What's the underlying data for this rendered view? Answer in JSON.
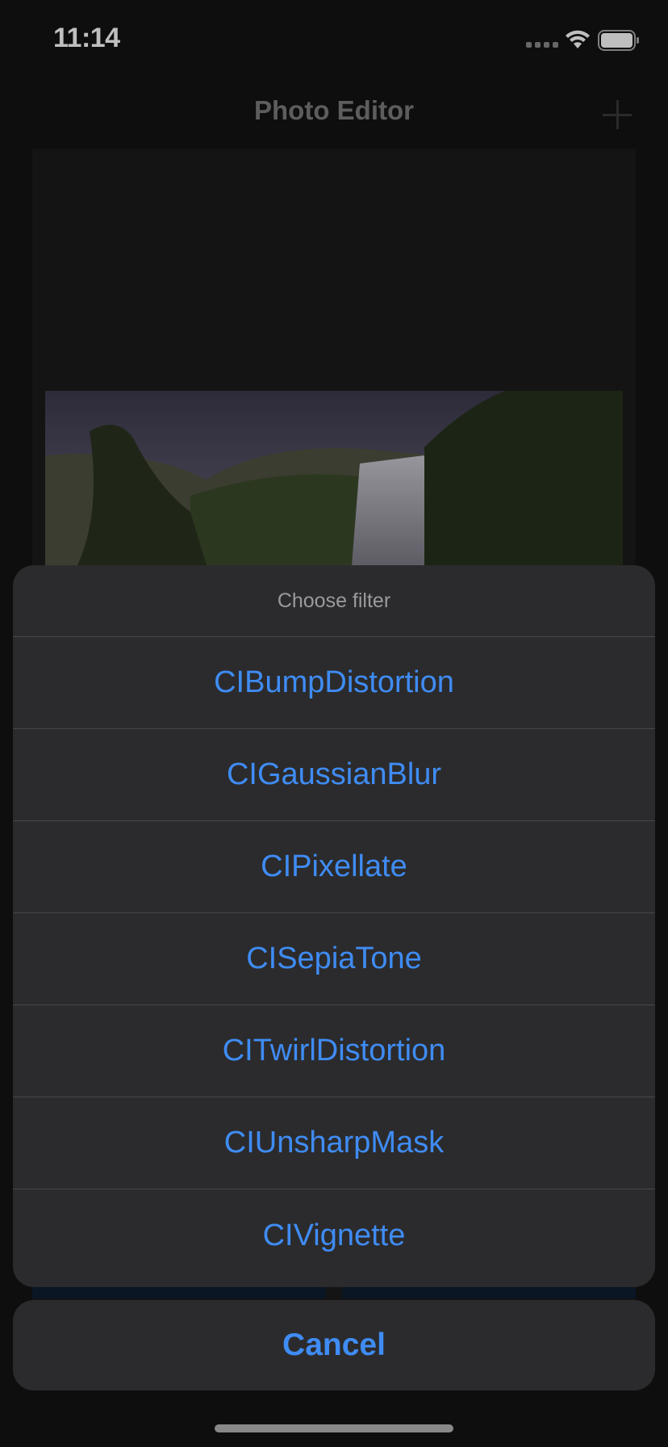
{
  "status_bar": {
    "time": "11:14"
  },
  "nav": {
    "title": "Photo Editor",
    "add_icon": "plus-icon"
  },
  "action_sheet": {
    "title": "Choose filter",
    "options": [
      "CIBumpDistortion",
      "CIGaussianBlur",
      "CIPixellate",
      "CISepiaTone",
      "CITwirlDistortion",
      "CIUnsharpMask",
      "CIVignette"
    ],
    "cancel_label": "Cancel"
  },
  "colors": {
    "accent": "#3f8cf4",
    "sheet_bg": "#2b2b2d",
    "background": "#131313"
  }
}
